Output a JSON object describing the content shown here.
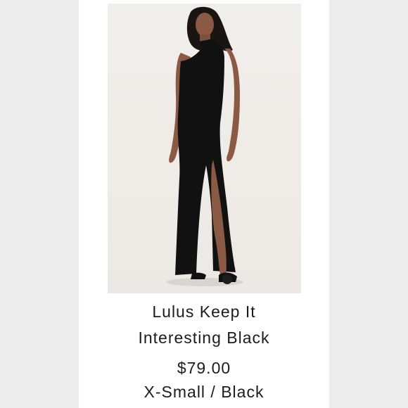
{
  "product": {
    "title_line1": "Lulus Keep It",
    "title_line2": "Interesting Black",
    "price": "$79.00",
    "variant": "X-Small / Black",
    "image_subject": "black one-shoulder maxi dress with thigh slit"
  },
  "colors": {
    "background": "#ececec",
    "card": "#ffffff",
    "text": "#1c1c1c",
    "dress": "#111111",
    "skin": "#8a5a44"
  }
}
